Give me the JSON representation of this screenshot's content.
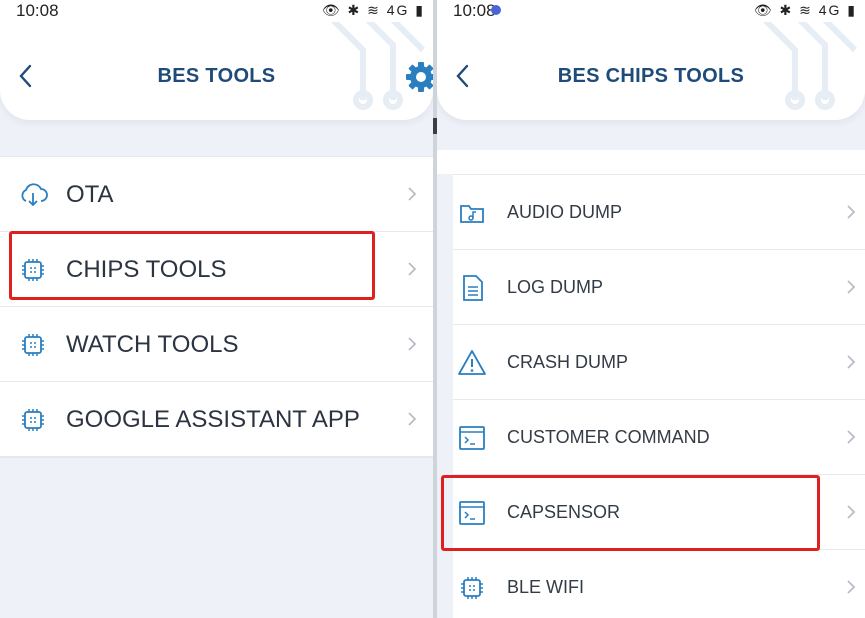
{
  "left_screen": {
    "status": {
      "time": "10:08",
      "icons": "👁 ✱ ≋ 4G ▮"
    },
    "header": {
      "title": "BES TOOLS"
    },
    "items": [
      {
        "label": "OTA",
        "icon": "cloud-download-icon"
      },
      {
        "label": "CHIPS TOOLS",
        "icon": "chip-icon"
      },
      {
        "label": "WATCH TOOLS",
        "icon": "chip-icon"
      },
      {
        "label": "GOOGLE ASSISTANT APP",
        "icon": "chip-icon"
      }
    ],
    "highlighted_item": "CHIPS TOOLS"
  },
  "right_screen": {
    "status": {
      "time": "10:08",
      "icons": "👁 ✱ ≋ 4G ▮"
    },
    "header": {
      "title": "BES CHIPS TOOLS"
    },
    "items": [
      {
        "label": "AUDIO DUMP",
        "icon": "audio-folder-icon"
      },
      {
        "label": "LOG DUMP",
        "icon": "document-icon"
      },
      {
        "label": "CRASH DUMP",
        "icon": "warning-icon"
      },
      {
        "label": "CUSTOMER COMMAND",
        "icon": "terminal-icon"
      },
      {
        "label": "CAPSENSOR",
        "icon": "terminal-icon"
      },
      {
        "label": "BLE WIFI",
        "icon": "chip-icon"
      }
    ],
    "highlighted_item": "CAPSENSOR"
  },
  "colors": {
    "accent": "#2a7fc1",
    "title": "#1f4b78",
    "highlight": "#e02020",
    "background": "#eef2f8"
  }
}
